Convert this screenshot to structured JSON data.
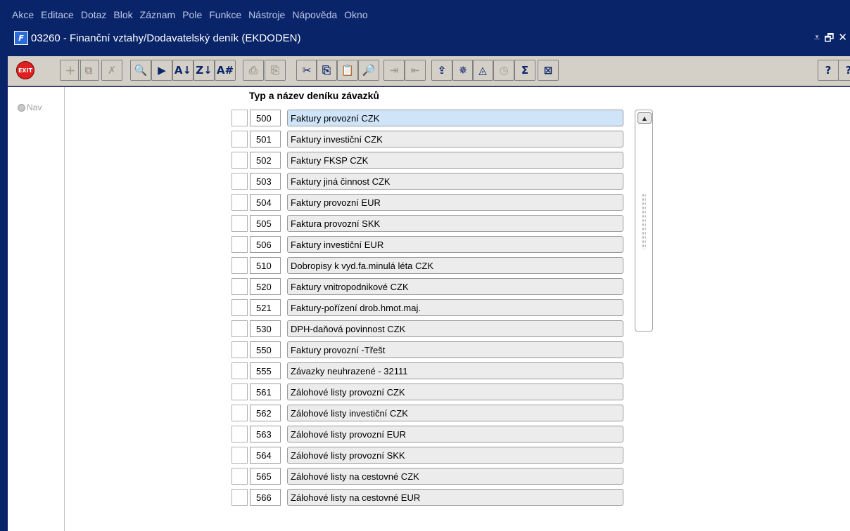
{
  "menu": [
    "Akce",
    "Editace",
    "Dotaz",
    "Blok",
    "Záznam",
    "Pole",
    "Funkce",
    "Nástroje",
    "Nápověda",
    "Okno"
  ],
  "window": {
    "icon_label": "F",
    "title": "03260 - Finanční vztahy/Dodavatelský deník (EKDODEN)",
    "controls": [
      "⩡",
      "🗗",
      "✕"
    ]
  },
  "toolbar": {
    "exit_label": "EXIT",
    "buttons": [
      {
        "icon": "new-record-icon",
        "glyph": "＋",
        "enabled": false
      },
      {
        "icon": "copy-record-icon",
        "glyph": "⧉",
        "enabled": false
      },
      {
        "icon": "delete-record-icon",
        "glyph": "✗",
        "enabled": false
      },
      {
        "icon": "query-enter-icon",
        "glyph": "🔍",
        "enabled": true
      },
      {
        "icon": "query-execute-icon",
        "glyph": "▶",
        "enabled": true
      },
      {
        "icon": "sort-asc-icon",
        "glyph": "A↓",
        "enabled": true
      },
      {
        "icon": "sort-desc-icon",
        "glyph": "Z↓",
        "enabled": true
      },
      {
        "icon": "sort-multi-icon",
        "glyph": "A#",
        "enabled": true
      },
      {
        "icon": "print-icon",
        "glyph": "⎙",
        "enabled": false
      },
      {
        "icon": "print-preview-icon",
        "glyph": "⎘",
        "enabled": false
      },
      {
        "icon": "cut-icon",
        "glyph": "✂",
        "enabled": true
      },
      {
        "icon": "copy-icon",
        "glyph": "⎘",
        "enabled": true
      },
      {
        "icon": "paste-icon",
        "glyph": "📋",
        "enabled": false
      },
      {
        "icon": "find-icon",
        "glyph": "🔎",
        "enabled": true
      },
      {
        "icon": "indent-icon",
        "glyph": "⇥",
        "enabled": false
      },
      {
        "icon": "outdent-icon",
        "glyph": "⇤",
        "enabled": false
      },
      {
        "icon": "export-icon",
        "glyph": "⇪",
        "enabled": true
      },
      {
        "icon": "tools-icon",
        "glyph": "✵",
        "enabled": true
      },
      {
        "icon": "view-icon",
        "glyph": "◬",
        "enabled": true
      },
      {
        "icon": "calendar-icon",
        "glyph": "◷",
        "enabled": false
      },
      {
        "icon": "sum-icon",
        "glyph": "Σ",
        "enabled": true
      },
      {
        "icon": "excel-icon",
        "glyph": "⊠",
        "enabled": true
      },
      {
        "icon": "help-icon",
        "glyph": "?",
        "enabled": true
      },
      {
        "icon": "context-help-icon",
        "glyph": "?",
        "enabled": true
      }
    ]
  },
  "nav": {
    "label": "Nav"
  },
  "form": {
    "column_header": "Typ a název deníku závazků",
    "rows": [
      {
        "code": "500",
        "name": "Faktury provozní CZK"
      },
      {
        "code": "501",
        "name": "Faktury investiční CZK"
      },
      {
        "code": "502",
        "name": "Faktury FKSP CZK"
      },
      {
        "code": "503",
        "name": "Faktury jiná činnost CZK"
      },
      {
        "code": "504",
        "name": "Faktury provozní EUR"
      },
      {
        "code": "505",
        "name": "Faktura provozní SKK"
      },
      {
        "code": "506",
        "name": "Faktury investiční EUR"
      },
      {
        "code": "510",
        "name": "Dobropisy k vyd.fa.minulá léta CZK"
      },
      {
        "code": "520",
        "name": "Faktury vnitropodnikové CZK"
      },
      {
        "code": "521",
        "name": "Faktury-pořízení drob.hmot.maj."
      },
      {
        "code": "530",
        "name": "DPH-daňová povinnost CZK"
      },
      {
        "code": "550",
        "name": "Faktury provozní -Třešt"
      },
      {
        "code": "555",
        "name": "Závazky neuhrazené - 32111"
      },
      {
        "code": "561",
        "name": "Zálohové listy provozní CZK"
      },
      {
        "code": "562",
        "name": "Zálohové listy investiční CZK"
      },
      {
        "code": "563",
        "name": "Zálohové listy provozní EUR"
      },
      {
        "code": "564",
        "name": "Zálohové listy provozní SKK"
      },
      {
        "code": "565",
        "name": "Zálohové listy na cestovné CZK"
      },
      {
        "code": "566",
        "name": "Zálohové listy na cestovné EUR"
      }
    ]
  },
  "scrollbar": {
    "up_glyph": "▲"
  }
}
